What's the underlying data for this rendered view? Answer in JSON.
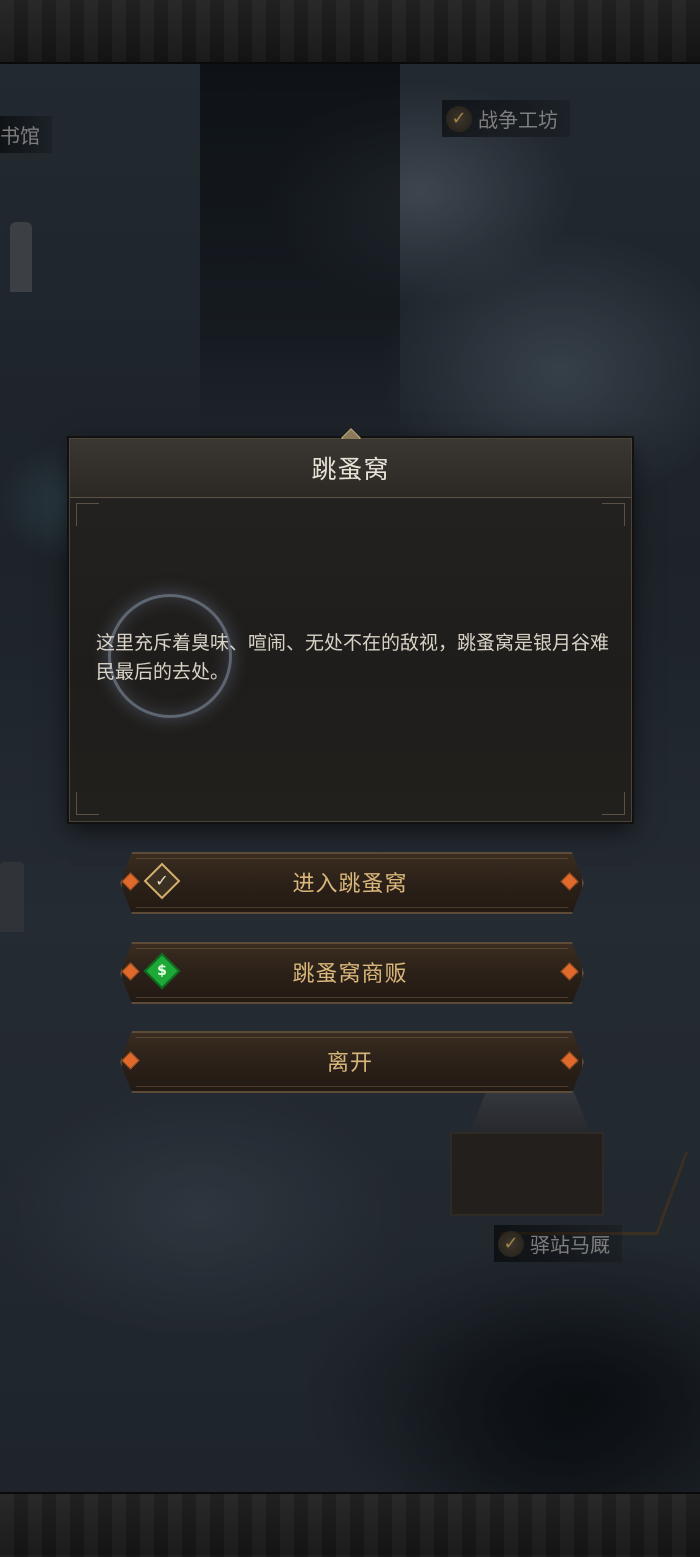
{
  "map": {
    "labels": {
      "library": "书馆",
      "war_workshop": "战争工坊",
      "stable": "驿站马厩"
    }
  },
  "dialog": {
    "title": "跳蚤窝",
    "description": "这里充斥着臭味、喧闹、无处不在的敌视，跳蚤窝是银月谷难民最后的去处。"
  },
  "actions": {
    "enter": "进入跳蚤窝",
    "shop": "跳蚤窝商贩",
    "leave": "离开"
  },
  "icons": {
    "enter": "check-diamond-icon",
    "shop": "money-bag-icon",
    "shop_symbol": "$",
    "check_symbol": "✓"
  },
  "colors": {
    "button_text": "#d9b67a",
    "gem": "#e06a2c",
    "shop_icon": "#1ea838"
  }
}
